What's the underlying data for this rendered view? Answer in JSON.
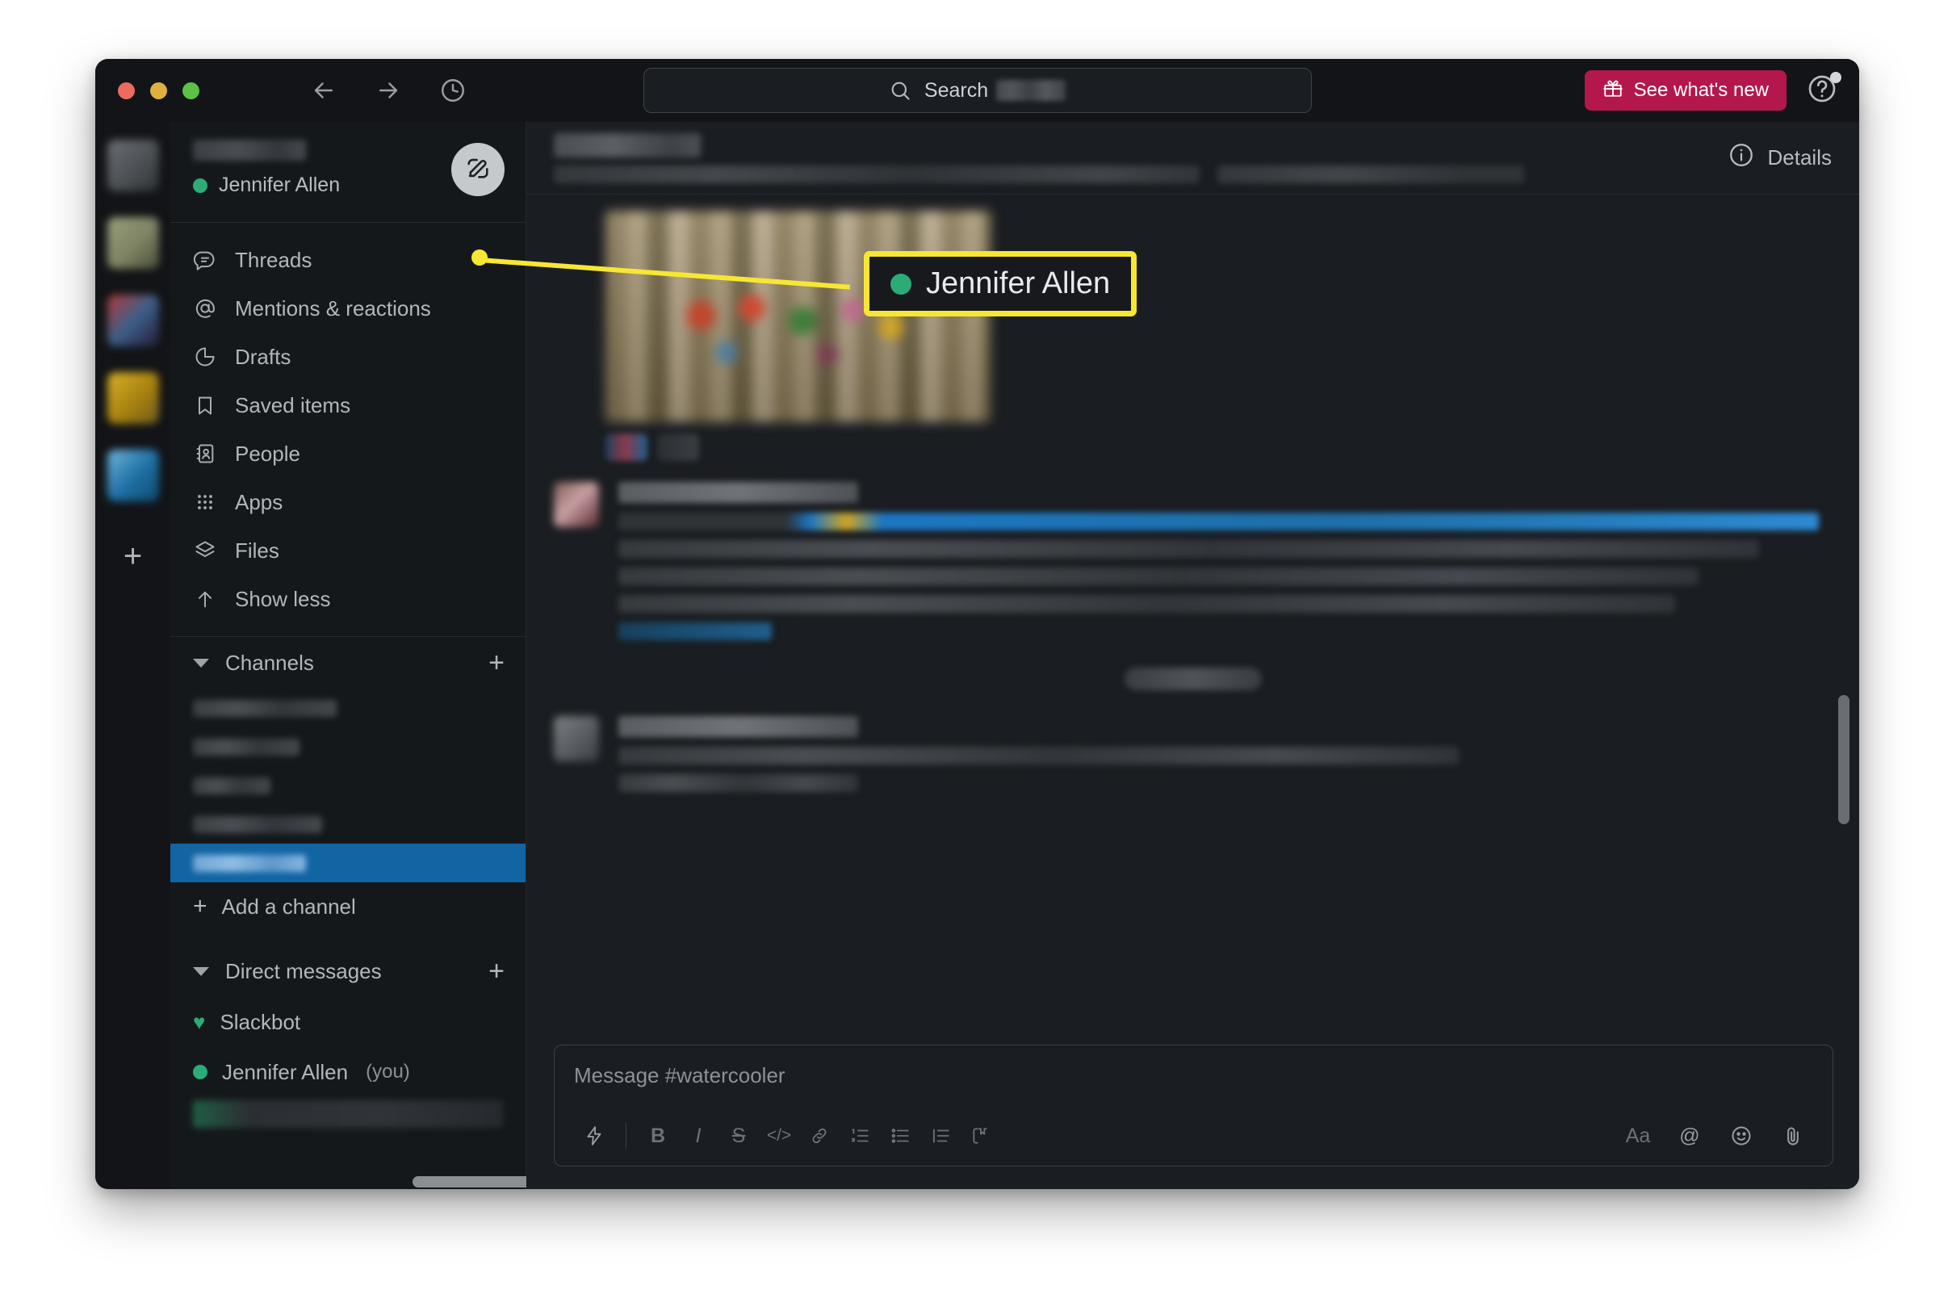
{
  "window": {
    "traffic_lights": [
      "close",
      "minimize",
      "maximize"
    ]
  },
  "titlebar": {
    "back_icon": "arrow-left-icon",
    "forward_icon": "arrow-right-icon",
    "history_icon": "clock-icon",
    "search": {
      "icon": "search-icon",
      "label": "Search",
      "workspace_redacted": true
    },
    "whats_new_label": "See what's new",
    "whats_new_icon": "gift-icon",
    "whats_new_color": "#b4174c",
    "help_icon": "help-circle-icon",
    "help_has_badge": true
  },
  "rail": {
    "workspaces": [
      {
        "name": "workspace-1"
      },
      {
        "name": "workspace-2"
      },
      {
        "name": "workspace-3"
      },
      {
        "name": "workspace-4"
      },
      {
        "name": "workspace-5"
      }
    ],
    "add_label": "+"
  },
  "sidebar": {
    "workspace_name_redacted": true,
    "user": {
      "name": "Jennifer Allen",
      "presence": "active",
      "presence_color": "#2bac76"
    },
    "compose_icon": "compose-pencil-icon",
    "nav_items": [
      {
        "label": "Threads",
        "icon": "threads-icon"
      },
      {
        "label": "Mentions & reactions",
        "icon": "at-icon"
      },
      {
        "label": "Drafts",
        "icon": "drafts-icon"
      },
      {
        "label": "Saved items",
        "icon": "bookmark-icon"
      },
      {
        "label": "People",
        "icon": "people-icon"
      },
      {
        "label": "Apps",
        "icon": "apps-grid-icon"
      },
      {
        "label": "Files",
        "icon": "files-layers-icon"
      },
      {
        "label": "Show less",
        "icon": "arrow-up-icon"
      }
    ],
    "channels": {
      "title": "Channels",
      "add_button": "+",
      "items": [
        {
          "redacted": true,
          "width": 178,
          "selected": false
        },
        {
          "redacted": true,
          "width": 132,
          "selected": false
        },
        {
          "redacted": true,
          "width": 96,
          "selected": false
        },
        {
          "redacted": true,
          "width": 160,
          "selected": false
        },
        {
          "redacted": true,
          "width": 140,
          "selected": true
        }
      ],
      "add_channel_label": "Add a channel",
      "selected_color": "#1264a3"
    },
    "direct_messages": {
      "title": "Direct messages",
      "add_button": "+",
      "items": [
        {
          "label": "Slackbot",
          "icon": "heart-icon",
          "presence": "heart"
        },
        {
          "label": "Jennifer Allen",
          "suffix": "(you)",
          "presence": "active"
        },
        {
          "redacted": true
        }
      ]
    }
  },
  "channel_header": {
    "title_redacted": true,
    "meta_redacted": true,
    "details_label": "Details",
    "details_icon": "info-circle-icon"
  },
  "messages": [
    {
      "type": "image-attachment",
      "redacted": true,
      "reactions": [
        {
          "redacted": true
        },
        {
          "redacted": true
        }
      ]
    },
    {
      "type": "text",
      "avatar_redacted": true,
      "sender_redacted": true,
      "has_link": true,
      "lines_redacted": 5
    },
    {
      "type": "text",
      "avatar_redacted": true,
      "sender_redacted": true,
      "lines_redacted": 3
    }
  ],
  "composer": {
    "placeholder": "Message #watercooler",
    "toolbar_left": [
      {
        "icon": "lightning-icon",
        "label": "⚡"
      },
      {
        "icon": "bold-icon",
        "label": "B"
      },
      {
        "icon": "italic-icon",
        "label": "I"
      },
      {
        "icon": "strikethrough-icon",
        "label": "S"
      },
      {
        "icon": "code-icon",
        "label": "</>"
      },
      {
        "icon": "link-icon",
        "label": "🔗"
      },
      {
        "icon": "ordered-list-icon",
        "label": "1."
      },
      {
        "icon": "bulleted-list-icon",
        "label": "•"
      },
      {
        "icon": "blockquote-icon",
        "label": "┃"
      },
      {
        "icon": "code-block-icon",
        "label": "{ }"
      }
    ],
    "toolbar_right": [
      {
        "icon": "formatting-aa-icon",
        "label": "Aa"
      },
      {
        "icon": "mention-at-icon",
        "label": "@"
      },
      {
        "icon": "emoji-icon",
        "label": "☺"
      },
      {
        "icon": "attachment-icon",
        "label": "📎"
      }
    ]
  },
  "annotation": {
    "label": "Jennifer Allen",
    "presence_color": "#2bac76",
    "highlight_color": "#f7e733",
    "box_background": "#17191d"
  }
}
